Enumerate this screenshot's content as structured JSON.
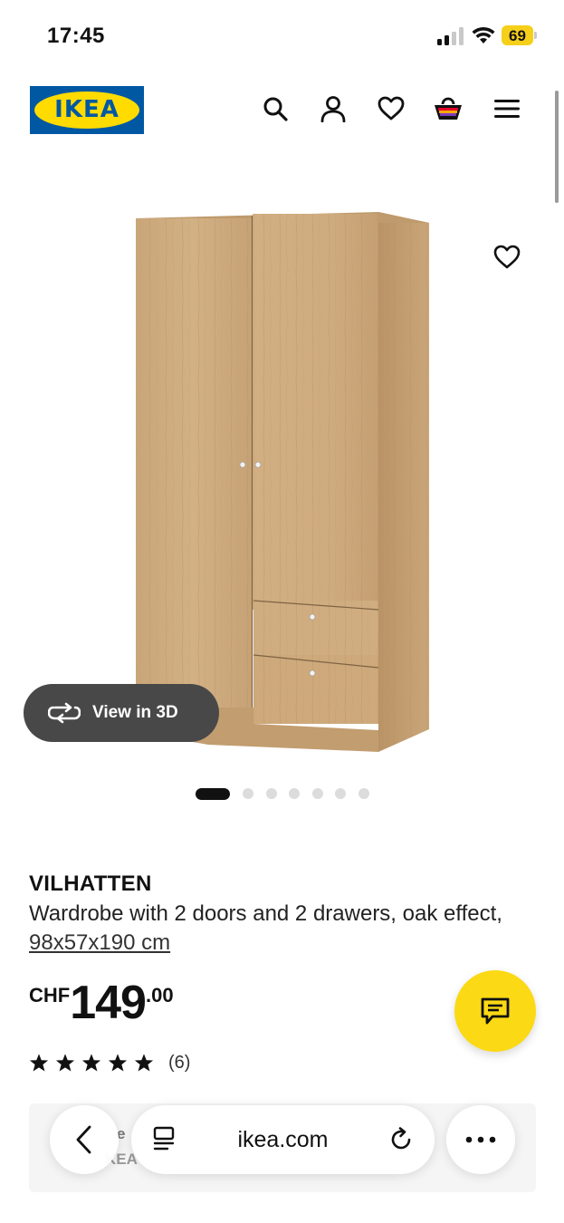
{
  "status_bar": {
    "time": "17:45",
    "battery_level": "69",
    "battery_color": "#f6cf1a"
  },
  "header": {
    "logo_text": "IKEA",
    "logo_colors": {
      "blue": "#0058a3",
      "yellow": "#ffdb00"
    },
    "icons": [
      "search-icon",
      "account-icon",
      "favourites-icon",
      "basket-icon",
      "menu-icon"
    ]
  },
  "product_image": {
    "view_3d_label": "View in 3D",
    "favourite_icon": "heart-icon"
  },
  "carousel": {
    "total_dots": 7,
    "active_index": 0
  },
  "product": {
    "name": "VILHATTEN",
    "description": "Wardrobe with 2 doors and 2 drawers, oak effect, ",
    "dimensions_link": "98x57x190 cm",
    "currency": "CHF",
    "price_integer": "149",
    "price_decimal": ".00",
    "rating_stars": 5,
    "review_count": "(6)"
  },
  "chat_button": {
    "icon": "chat-icon",
    "color": "#fbd914"
  },
  "under_card": {
    "text1": "e",
    "text2": "KEA"
  },
  "browser": {
    "url": "ikea.com",
    "icons": [
      "back-icon",
      "tabs-icon",
      "reload-icon",
      "more-icon"
    ]
  }
}
